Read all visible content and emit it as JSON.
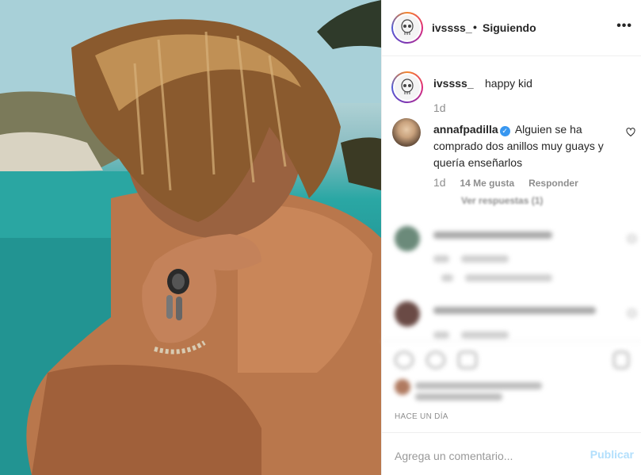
{
  "post": {
    "author": "ivssss_",
    "follow_status": "Siguiendo",
    "more_icon": "more-options-icon",
    "caption": {
      "username": "ivssss_",
      "text": "happy kid",
      "time": "1d"
    },
    "comments": [
      {
        "username": "annafpadilla",
        "verified": true,
        "text": "Alguien se ha comprado dos anillos muy guays y quería enseñarlos",
        "time": "1d",
        "likes": "14 Me gusta",
        "reply_label": "Responder",
        "view_replies": "Ver respuestas (1)"
      }
    ],
    "date": "HACE UN DÍA"
  },
  "composer": {
    "placeholder": "Agrega un comentario...",
    "publish_label": "Publicar"
  },
  "colors": {
    "accent_blue": "#3897f0",
    "publish_disabled": "#b2dffc",
    "muted_text": "#8e8e8e"
  }
}
